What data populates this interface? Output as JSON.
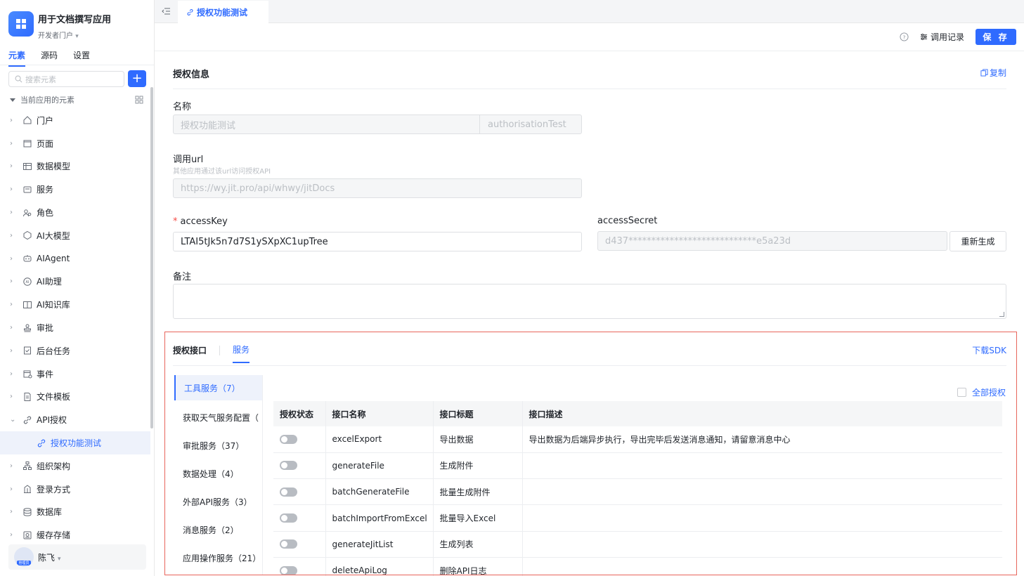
{
  "app": {
    "name": "用于文档撰写应用",
    "portal": "开发者门户"
  },
  "sidebar": {
    "tabs": [
      {
        "label": "元素"
      },
      {
        "label": "源码"
      },
      {
        "label": "设置"
      }
    ],
    "search_placeholder": "搜索元素",
    "tree_root": "当前应用的元素",
    "items": [
      {
        "label": "门户",
        "icon": "home-icon"
      },
      {
        "label": "页面",
        "icon": "page-icon"
      },
      {
        "label": "数据模型",
        "icon": "table-icon"
      },
      {
        "label": "服务",
        "icon": "service-icon"
      },
      {
        "label": "角色",
        "icon": "role-icon"
      },
      {
        "label": "AI大模型",
        "icon": "ai-model-icon"
      },
      {
        "label": "AIAgent",
        "icon": "robot-icon"
      },
      {
        "label": "AI助理",
        "icon": "ai-assistant-icon"
      },
      {
        "label": "AI知识库",
        "icon": "book-icon"
      },
      {
        "label": "审批",
        "icon": "stamp-icon"
      },
      {
        "label": "后台任务",
        "icon": "task-icon"
      },
      {
        "label": "事件",
        "icon": "event-icon"
      },
      {
        "label": "文件模板",
        "icon": "file-template-icon"
      },
      {
        "label": "API授权",
        "icon": "link-icon"
      },
      {
        "label": "授权功能测试",
        "icon": "link-icon",
        "child": true
      },
      {
        "label": "组织架构",
        "icon": "org-icon"
      },
      {
        "label": "登录方式",
        "icon": "login-icon"
      },
      {
        "label": "数据库",
        "icon": "database-icon"
      },
      {
        "label": "缓存存储",
        "icon": "cache-icon"
      }
    ],
    "user": {
      "name": "陈飞",
      "badge": "管理员"
    }
  },
  "tabbar": {
    "active_tab": "授权功能测试"
  },
  "toolbar": {
    "log_label": "调用记录",
    "save_label": "保 存"
  },
  "auth_info": {
    "title": "授权信息",
    "copy_label": "复制",
    "name_label": "名称",
    "name_value": "授权功能测试",
    "name_id": "authorisationTest",
    "url_label": "调用url",
    "url_hint": "其他应用通过该url访问授权API",
    "url_value": "https://wy.jit.pro/api/whwy/jitDocs",
    "access_key_label": "accessKey",
    "access_key_value": "LTAI5tJk5n7d7S1ySXpXC1upTree",
    "access_secret_label": "accessSecret",
    "access_secret_value": "d437****************************e5a23d",
    "regen_label": "重新生成",
    "remark_label": "备注"
  },
  "api_section": {
    "title": "授权接口",
    "tab": "服务",
    "sdk_label": "下载SDK",
    "all_auth_label": "全部授权",
    "services": [
      "工具服务（7）",
      "获取天气服务配置（",
      "审批服务（37）",
      "数据处理（4）",
      "外部API服务（3）",
      "消息服务（2）",
      "应用操作服务（21）"
    ],
    "columns": [
      "授权状态",
      "接口名称",
      "接口标题",
      "接口描述"
    ],
    "rows": [
      {
        "name": "excelExport",
        "title": "导出数据",
        "desc": "导出数据为后端异步执行，导出完毕后发送消息通知，请留意消息中心",
        "enabled": false
      },
      {
        "name": "generateFile",
        "title": "生成附件",
        "desc": "",
        "enabled": false
      },
      {
        "name": "batchGenerateFile",
        "title": "批量生成附件",
        "desc": "",
        "enabled": false
      },
      {
        "name": "batchImportFromExcel",
        "title": "批量导入Excel",
        "desc": "",
        "enabled": false
      },
      {
        "name": "generateJitList",
        "title": "生成列表",
        "desc": "",
        "enabled": false
      },
      {
        "name": "deleteApiLog",
        "title": "删除API日志",
        "desc": "",
        "enabled": false
      }
    ]
  },
  "colors": {
    "accent": "#2f6bff",
    "highlight": "#e8655c"
  }
}
